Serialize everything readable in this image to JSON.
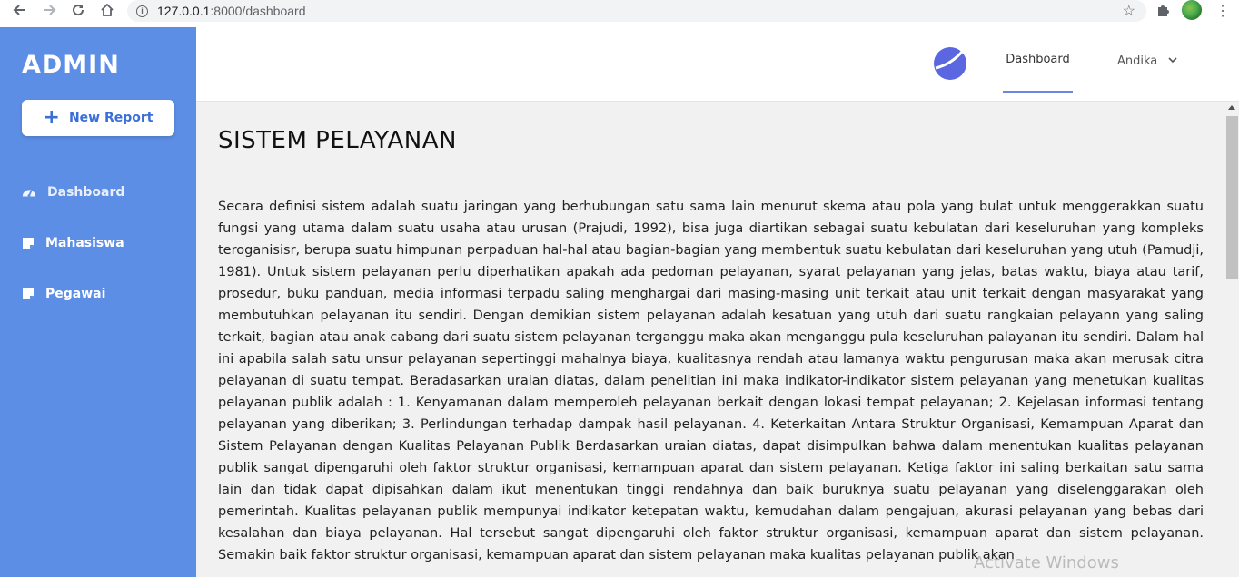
{
  "browser": {
    "url_host": "127.0.0.1",
    "url_path": ":8000/dashboard"
  },
  "sidebar": {
    "brand": "ADMIN",
    "new_report_label": "New Report",
    "items": [
      {
        "label": "Dashboard",
        "icon": "tachometer-icon"
      },
      {
        "label": "Mahasiswa",
        "icon": "note-icon"
      },
      {
        "label": "Pegawai",
        "icon": "note-icon"
      }
    ]
  },
  "header": {
    "nav_dashboard": "Dashboard",
    "user_name": "Andika"
  },
  "main": {
    "title": "SISTEM PELAYANAN",
    "body": "Secara definisi sistem adalah suatu jaringan yang berhubungan satu sama lain menurut skema atau pola yang bulat untuk menggerakkan suatu fungsi yang utama dalam suatu usaha atau urusan (Prajudi, 1992), bisa juga diartikan sebagai suatu kebulatan dari keseluruhan yang kompleks teroganisisr, berupa suatu himpunan perpaduan hal-hal atau bagian-bagian yang membentuk suatu kebulatan dari keseluruhan yang utuh (Pamudji, 1981). Untuk sistem pelayanan perlu diperhatikan apakah ada pedoman pelayanan, syarat pelayanan yang jelas, batas waktu, biaya atau tarif, prosedur, buku panduan, media informasi terpadu saling menghargai dari masing-masing unit terkait atau unit terkait dengan masyarakat yang membutuhkan pelayanan itu sendiri. Dengan demikian sistem pelayanan adalah kesatuan yang utuh dari suatu rangkaian pelayann yang saling terkait, bagian atau anak cabang dari suatu sistem pelayanan terganggu maka akan menganggu pula keseluruhan palayanan itu sendiri. Dalam hal ini apabila salah satu unsur pelayanan sepertinggi mahalnya biaya, kualitasnya rendah atau lamanya waktu pengurusan maka akan merusak citra pelayanan di suatu tempat. Beradasarkan uraian diatas, dalam penelitian ini maka indikator-indikator sistem pelayanan yang menetukan kualitas pelayanan publik adalah : 1. Kenyamanan dalam memperoleh pelayanan berkait dengan lokasi tempat pelayanan; 2. Kejelasan informasi tentang pelayanan yang diberikan; 3. Perlindungan terhadap dampak hasil pelayanan. 4. Keterkaitan Antara Struktur Organisasi, Kemampuan Aparat dan Sistem Pelayanan dengan Kualitas Pelayanan Publik Berdasarkan uraian diatas, dapat disimpulkan bahwa dalam menentukan kualitas pelayanan publik sangat dipengaruhi oleh faktor struktur organisasi, kemampuan aparat dan sistem pelayanan. Ketiga faktor ini saling berkaitan satu sama lain dan tidak dapat dipisahkan dalam ikut menentukan tinggi rendahnya dan baik buruknya suatu pelayanan yang diselenggarakan oleh pemerintah. Kualitas pelayanan publik mempunyai indikator ketepatan waktu, kemudahan dalam pengajuan, akurasi pelayanan yang bebas dari kesalahan dan biaya pelayanan. Hal tersebut sangat dipengaruhi oleh faktor struktur organisasi, kemampuan aparat dan sistem pelayanan. Semakin baik faktor struktur organisasi, kemampuan aparat dan sistem pelayanan maka kualitas pelayanan publik akan"
  },
  "watermark": "Activate Windows",
  "colors": {
    "sidebar_bg": "#5d8ee5",
    "accent": "#3a6fd8",
    "main_bg": "#f1f1f1"
  }
}
